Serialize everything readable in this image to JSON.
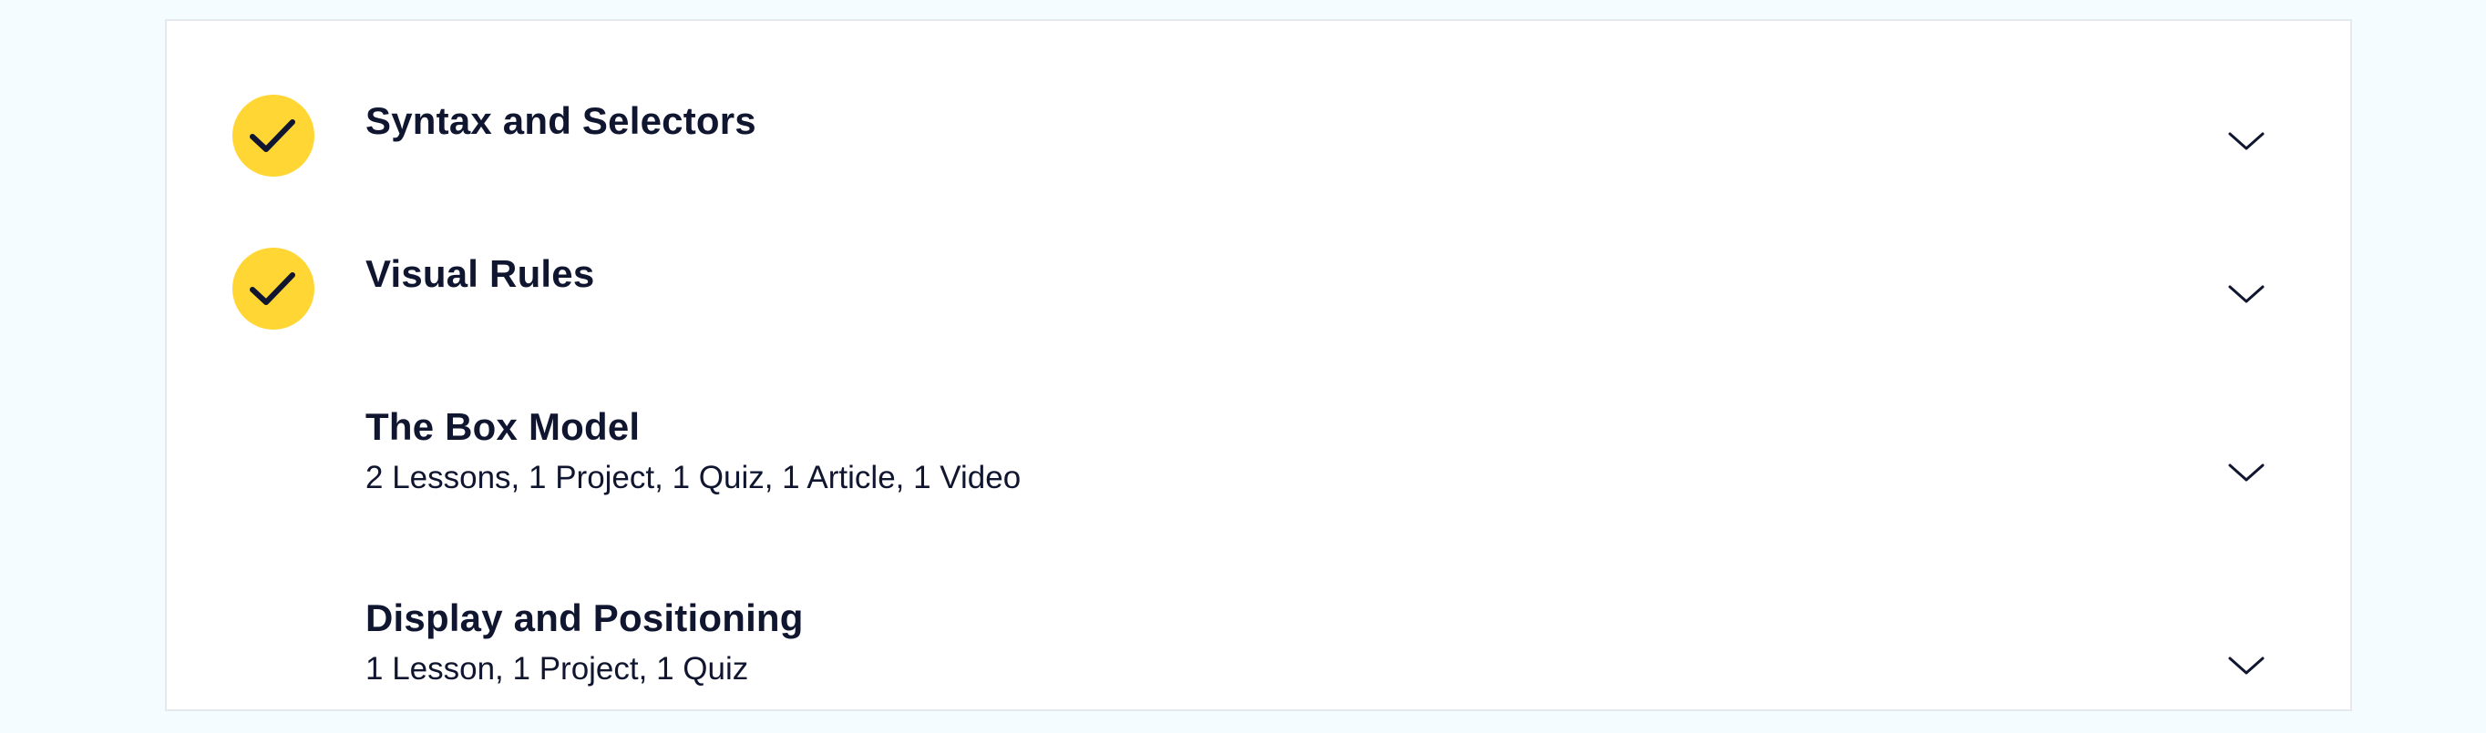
{
  "colors": {
    "page_background": "#f5fcff",
    "card_background": "#ffffff",
    "completed_badge": "#ffd633",
    "text": "#10162f"
  },
  "modules": [
    {
      "title": "Syntax and Selectors",
      "subtitle": "",
      "completed": true,
      "status_icon": "check-icon",
      "toggle_icon": "chevron-down-icon"
    },
    {
      "title": "Visual Rules",
      "subtitle": "",
      "completed": true,
      "status_icon": "check-icon",
      "toggle_icon": "chevron-down-icon"
    },
    {
      "title": "The Box Model",
      "subtitle": "2 Lessons, 1 Project, 1 Quiz, 1 Article, 1 Video",
      "completed": false,
      "toggle_icon": "chevron-down-icon"
    },
    {
      "title": "Display and Positioning",
      "subtitle": "1 Lesson, 1 Project, 1 Quiz",
      "completed": false,
      "toggle_icon": "chevron-down-icon"
    }
  ]
}
